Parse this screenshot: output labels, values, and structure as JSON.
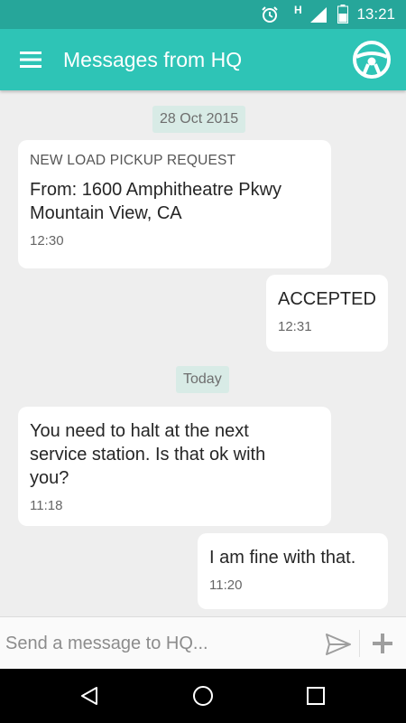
{
  "status_bar": {
    "time": "13:21",
    "network_label": "H",
    "icons": [
      "alarm-icon",
      "signal-icon",
      "battery-icon"
    ]
  },
  "app_bar": {
    "title": "Messages from HQ",
    "menu_icon": "menu-icon",
    "action_icon": "steering-wheel-icon"
  },
  "chat": {
    "date_1": "28 Oct 2015",
    "date_2": "Today",
    "messages": [
      {
        "direction": "incoming",
        "caption": "NEW LOAD PICKUP REQUEST",
        "line1": "From: 1600 Amphitheatre Pkwy",
        "line2": "Mountain View, CA",
        "time": "12:30"
      },
      {
        "direction": "outgoing",
        "text": "ACCEPTED",
        "time": "12:31"
      },
      {
        "direction": "incoming",
        "line1": "You need to halt at the next",
        "line2": "service station. Is that ok with",
        "line3": "you?",
        "time": "11:18"
      },
      {
        "direction": "outgoing",
        "text": "I am fine with that.",
        "time": "11:20"
      }
    ]
  },
  "composer": {
    "placeholder": "Send a message to HQ...",
    "value": "",
    "send_icon": "send-icon",
    "attach_icon": "plus-icon"
  },
  "nav_bar": {
    "icons": [
      "back-icon",
      "home-icon",
      "recents-icon"
    ]
  },
  "colors": {
    "status_bar": "#26a69a",
    "app_bar": "#2ec4b6",
    "background": "#eeeeee",
    "bubble": "#ffffff",
    "date_chip": "#d8ebe6"
  }
}
